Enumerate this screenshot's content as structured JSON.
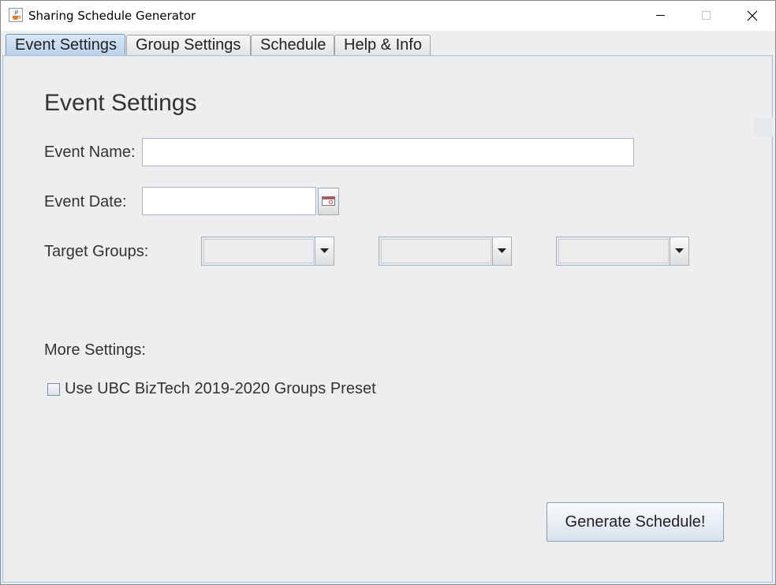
{
  "window": {
    "title": "Sharing Schedule Generator",
    "icon": "java-cup-icon"
  },
  "tabs": [
    {
      "label": "Event Settings",
      "active": true
    },
    {
      "label": "Group Settings",
      "active": false
    },
    {
      "label": "Schedule",
      "active": false
    },
    {
      "label": "Help & Info",
      "active": false
    }
  ],
  "event_settings": {
    "heading": "Event Settings",
    "event_name": {
      "label": "Event Name:",
      "value": ""
    },
    "event_date": {
      "label": "Event Date:",
      "value": "",
      "picker_icon": "calendar-icon"
    },
    "target_groups": {
      "label": "Target Groups:",
      "selects": [
        {
          "selected": ""
        },
        {
          "selected": ""
        },
        {
          "selected": ""
        }
      ]
    },
    "more_settings": {
      "label": "More Settings:",
      "preset_checkbox": {
        "label": "Use UBC BizTech 2019-2020 Groups Preset",
        "checked": false
      }
    },
    "generate_button": "Generate Schedule!"
  },
  "colors": {
    "active_tab": "#c5d9ee",
    "panel_bg": "#eeeeee",
    "panel_border": "#a8c4df"
  }
}
